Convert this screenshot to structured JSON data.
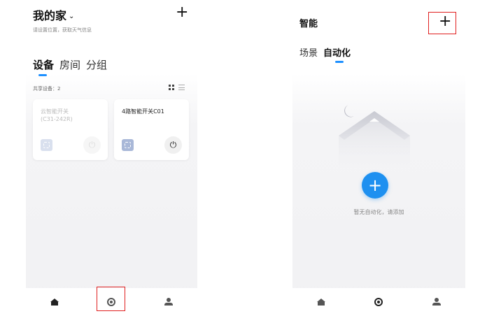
{
  "home": {
    "title": "我的家",
    "title_chevron": "⌄",
    "subtitle": "请设置位置，获取天气信息",
    "add_glyph": "+",
    "tabs": [
      {
        "label": "设备",
        "active": true
      },
      {
        "label": "房间",
        "active": false
      },
      {
        "label": "分组",
        "active": false
      }
    ],
    "shared_label": "共享设备：2",
    "devices": [
      {
        "name_line1": "云智能开关",
        "name_line2": "(C31-242R)",
        "state": "offline"
      },
      {
        "name_line1": "4路智能开关C01",
        "name_line2": "",
        "state": "online"
      }
    ],
    "power_glyph": "⏻"
  },
  "smart": {
    "title": "智能",
    "add_glyph": "+",
    "tabs": [
      {
        "label": "场景",
        "active": false
      },
      {
        "label": "自动化",
        "active": true
      }
    ],
    "empty_text": "暂无自动化，请添加",
    "fab_glyph": "+"
  },
  "bottom_nav": {
    "icons": [
      "home-icon",
      "smart-icon",
      "user-icon"
    ],
    "active_color": "#222222",
    "inactive_color": "#555555"
  },
  "colors": {
    "accent": "#1e90ff",
    "highlight": "#e02020"
  }
}
